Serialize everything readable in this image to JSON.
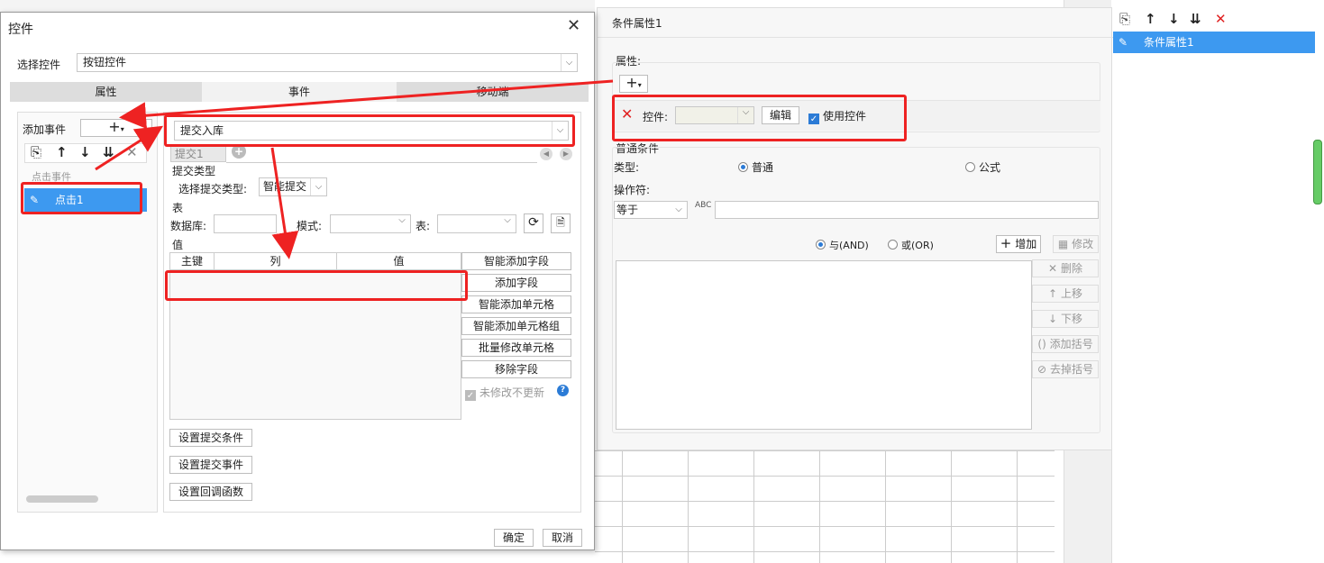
{
  "dialog": {
    "title": "控件",
    "select_control_label": "选择控件",
    "select_control_value": "按钮控件",
    "tabs": [
      {
        "label": "属性"
      },
      {
        "label": "事件"
      },
      {
        "label": "移动端"
      }
    ],
    "add_event_label": "添加事件",
    "event_group_label": "点击事件",
    "event_item": "点击1",
    "action_value": "提交入库",
    "submit_tab": "提交1",
    "submit_type_section": "提交类型",
    "submit_type_label": "选择提交类型:",
    "submit_type_value": "智能提交",
    "table_section": "表",
    "database_label": "数据库:",
    "mode_label": "模式:",
    "table_label": "表:",
    "value_section": "值",
    "columns": [
      "主键",
      "列",
      "值"
    ],
    "side_buttons": [
      "智能添加字段",
      "添加字段",
      "智能添加单元格",
      "智能添加单元格组",
      "批量修改单元格",
      "移除字段"
    ],
    "no_update_label": "未修改不更新",
    "bottom_buttons": [
      "设置提交条件",
      "设置提交事件",
      "设置回调函数"
    ],
    "ok": "确定",
    "cancel": "取消"
  },
  "condition": {
    "title": "条件属性1",
    "property_label": "属性:",
    "control_label": "控件:",
    "edit_button": "编辑",
    "use_control_label": "使用控件",
    "normal_condition": "普通条件",
    "type_label": "类型:",
    "type_normal": "普通",
    "type_formula": "公式",
    "operator_label": "操作符:",
    "operator_value": "等于",
    "and_label": "与(AND)",
    "or_label": "或(OR)",
    "add_button": "增加",
    "modify_button": "修改",
    "side_buttons": [
      "删除",
      "上移",
      "下移",
      "添加括号",
      "去掉括号"
    ]
  },
  "right_panel": {
    "item": "条件属性1"
  }
}
